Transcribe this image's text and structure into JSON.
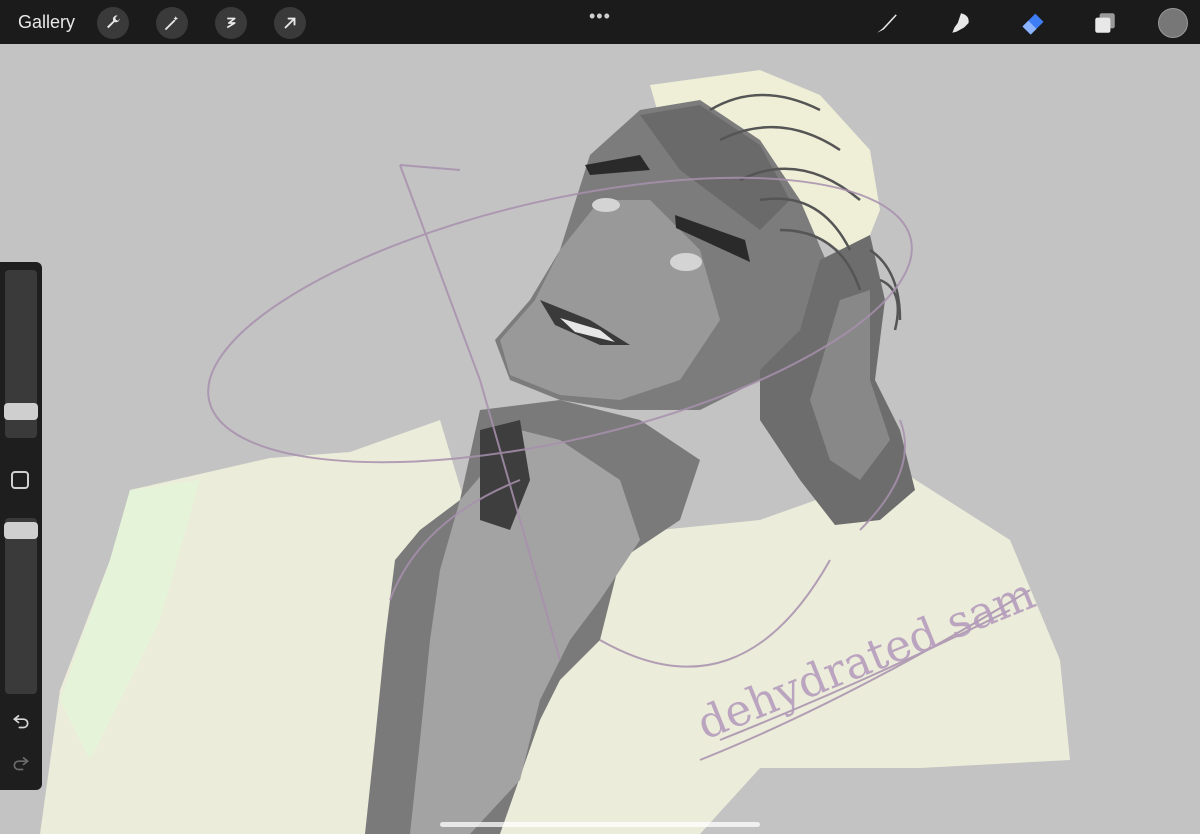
{
  "topbar": {
    "gallery_label": "Gallery",
    "left_tools": [
      "wrench-icon",
      "magic-wand-icon",
      "selection-icon",
      "transform-arrow-icon"
    ],
    "center_menu": "•••",
    "right_tools": [
      "brush-icon",
      "smudge-icon",
      "eraser-icon",
      "layers-icon",
      "color-swatch"
    ],
    "active_tool": "eraser-icon",
    "active_color": "#3d7df5",
    "current_color": "#777777"
  },
  "sidebar": {
    "brush_size_level": 0.25,
    "opacity_level": 0.95,
    "modify_button": "square-modify-icon",
    "undo": "undo-icon",
    "redo": "redo-icon"
  },
  "canvas": {
    "background_color": "#c3c3c3",
    "subject": "grayscale portrait sketch",
    "signature_text": "dehydrated sam"
  }
}
